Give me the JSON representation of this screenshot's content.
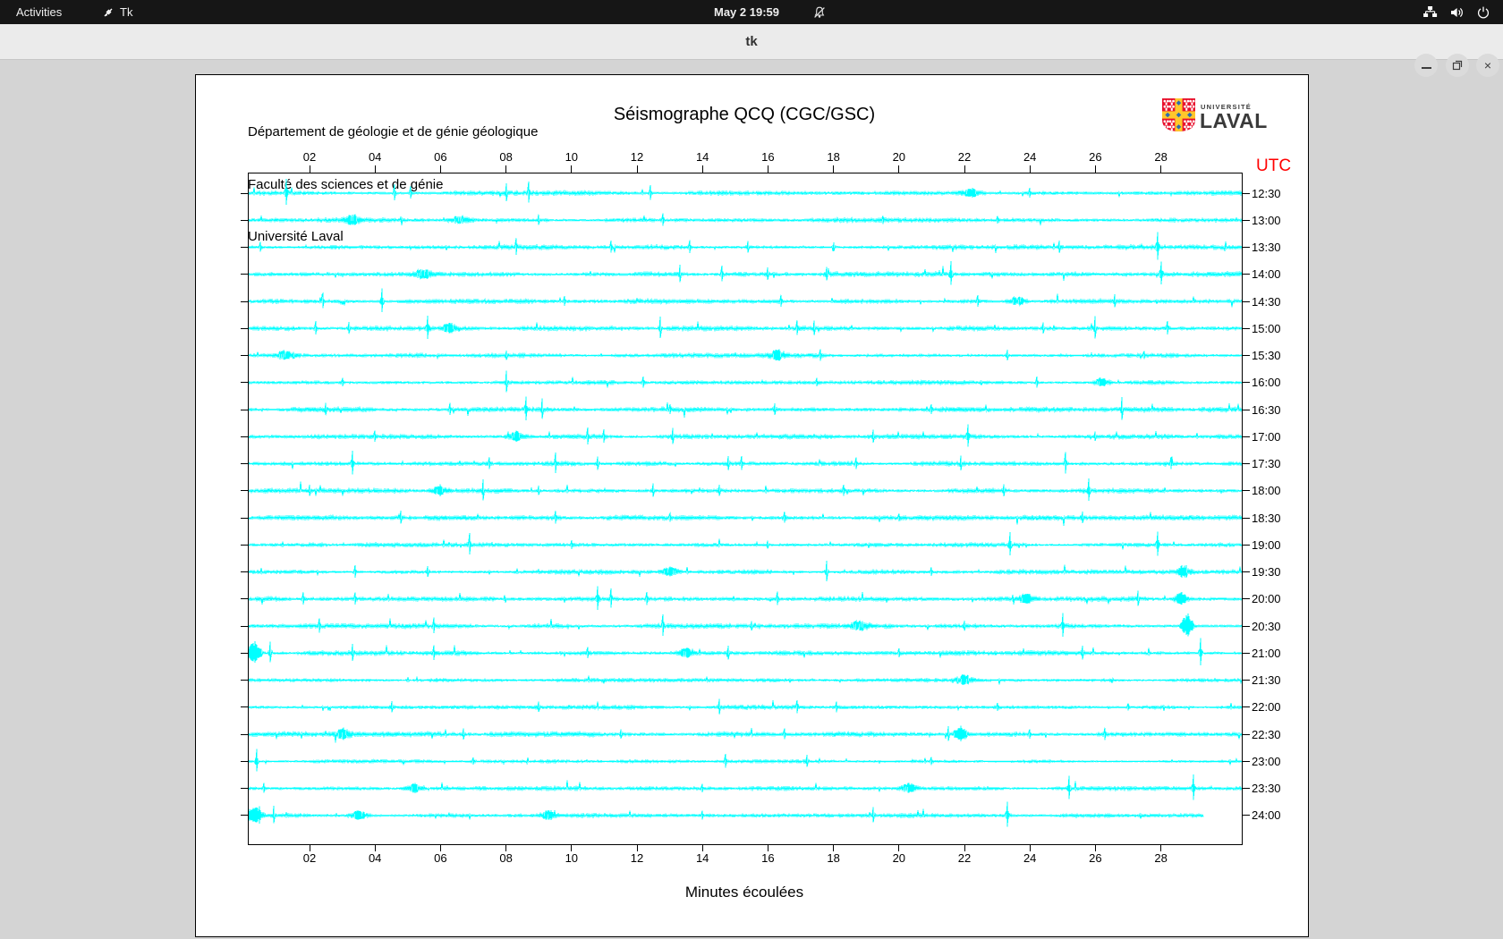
{
  "topbar": {
    "activities_label": "Activities",
    "app_indicator_label": "Tk",
    "clock": "May 2 19:59",
    "icons": [
      "tk-icon",
      "notifications-off-icon",
      "network-icon",
      "volume-icon",
      "power-icon"
    ]
  },
  "titlebar": {
    "title": "tk",
    "buttons": [
      "minimize",
      "maximize",
      "close"
    ]
  },
  "header": {
    "lines": [
      "Département de géologie et de génie géologique",
      "Faculté des sciences et de génie",
      "Université Laval"
    ]
  },
  "logo": {
    "line1": "UNIVERSITÉ",
    "line2": "LAVAL"
  },
  "colors": {
    "trace": "#00ffff",
    "utc_label": "#ff0000",
    "frame": "#000000",
    "logo_red": "#e8112d",
    "logo_yellow": "#ffc72c",
    "logo_blue": "#2b6db0",
    "topbar_bg": "#161616",
    "titlebar_bg": "#ebebeb"
  },
  "chart_data": {
    "type": "line",
    "subtype": "seismogram-helicorder",
    "title": "Séismographe QCQ (CGC/GSC)",
    "xlabel": "Minutes écoulées",
    "right_axis_label": "UTC",
    "x_range_minutes": [
      0,
      30
    ],
    "x_ticks": [
      "02",
      "04",
      "06",
      "08",
      "10",
      "12",
      "14",
      "16",
      "18",
      "20",
      "22",
      "24",
      "26",
      "28"
    ],
    "grid": false,
    "legend": false,
    "spike_fields": "minute, amplitude_px, half_width_px(optional)",
    "rows": [
      {
        "utc": "12:30",
        "noise": 1.8,
        "spikes": [
          [
            1.3,
            14
          ],
          [
            4.6,
            9
          ],
          [
            5.1,
            7
          ],
          [
            8.0,
            10
          ],
          [
            8.7,
            12
          ],
          [
            12.4,
            8
          ],
          [
            22.2,
            6,
            16
          ],
          [
            24.0,
            5
          ]
        ]
      },
      {
        "utc": "13:00",
        "noise": 1.8,
        "spikes": [
          [
            3.3,
            6,
            14
          ],
          [
            6.6,
            5,
            18
          ],
          [
            9.0,
            5
          ],
          [
            12.8,
            7
          ],
          [
            19.5,
            4
          ],
          [
            23.0,
            4
          ]
        ]
      },
      {
        "utc": "13:30",
        "noise": 1.8,
        "spikes": [
          [
            0.5,
            5
          ],
          [
            8.3,
            8
          ],
          [
            11.2,
            6
          ],
          [
            13.6,
            7
          ],
          [
            15.4,
            6
          ],
          [
            18.0,
            5
          ],
          [
            24.9,
            6
          ],
          [
            27.9,
            16
          ]
        ]
      },
      {
        "utc": "14:00",
        "noise": 2.0,
        "spikes": [
          [
            5.5,
            5,
            20
          ],
          [
            13.3,
            10
          ],
          [
            14.6,
            9
          ],
          [
            16.0,
            6
          ],
          [
            17.8,
            7
          ],
          [
            21.6,
            14
          ],
          [
            28.0,
            13
          ]
        ]
      },
      {
        "utc": "14:30",
        "noise": 1.8,
        "spikes": [
          [
            2.4,
            8
          ],
          [
            4.2,
            14
          ],
          [
            9.8,
            5
          ],
          [
            16.4,
            6
          ],
          [
            22.4,
            6
          ],
          [
            23.6,
            6,
            14
          ],
          [
            26.6,
            7
          ]
        ]
      },
      {
        "utc": "15:00",
        "noise": 1.8,
        "spikes": [
          [
            2.2,
            7
          ],
          [
            3.2,
            6
          ],
          [
            5.6,
            13
          ],
          [
            6.3,
            6,
            12
          ],
          [
            12.7,
            12
          ],
          [
            16.9,
            8
          ],
          [
            17.4,
            7
          ],
          [
            24.4,
            6
          ],
          [
            26.0,
            12
          ],
          [
            28.2,
            7
          ]
        ]
      },
      {
        "utc": "15:30",
        "noise": 1.7,
        "spikes": [
          [
            1.3,
            6,
            16
          ],
          [
            8.0,
            4
          ],
          [
            16.3,
            6,
            14
          ],
          [
            17.6,
            5
          ],
          [
            23.3,
            6
          ],
          [
            27.5,
            4
          ]
        ]
      },
      {
        "utc": "16:00",
        "noise": 1.7,
        "spikes": [
          [
            3.0,
            4
          ],
          [
            8.0,
            12
          ],
          [
            12.2,
            6
          ],
          [
            17.5,
            4
          ],
          [
            24.2,
            6
          ],
          [
            26.2,
            6,
            12
          ]
        ]
      },
      {
        "utc": "16:30",
        "noise": 2.2,
        "spikes": [
          [
            2.5,
            6
          ],
          [
            6.3,
            7
          ],
          [
            8.6,
            13
          ],
          [
            9.1,
            11
          ],
          [
            13.0,
            5
          ],
          [
            16.2,
            6
          ],
          [
            21.0,
            5
          ],
          [
            26.8,
            12
          ]
        ]
      },
      {
        "utc": "17:00",
        "noise": 1.8,
        "spikes": [
          [
            4.0,
            6
          ],
          [
            8.3,
            6,
            14
          ],
          [
            10.5,
            8
          ],
          [
            11.0,
            7
          ],
          [
            13.1,
            9
          ],
          [
            19.2,
            6
          ],
          [
            22.1,
            13
          ],
          [
            26.0,
            5
          ]
        ]
      },
      {
        "utc": "17:30",
        "noise": 1.8,
        "spikes": [
          [
            3.3,
            13
          ],
          [
            7.5,
            6
          ],
          [
            9.5,
            7
          ],
          [
            10.8,
            7
          ],
          [
            14.8,
            8
          ],
          [
            15.2,
            7
          ],
          [
            18.7,
            6
          ],
          [
            21.9,
            7
          ],
          [
            25.1,
            12
          ],
          [
            28.3,
            6
          ]
        ]
      },
      {
        "utc": "18:00",
        "noise": 1.8,
        "spikes": [
          [
            2.0,
            5
          ],
          [
            6.0,
            6,
            14
          ],
          [
            7.3,
            12
          ],
          [
            9.0,
            5
          ],
          [
            12.5,
            7
          ],
          [
            14.5,
            6
          ],
          [
            18.3,
            6
          ],
          [
            23.2,
            6
          ],
          [
            25.8,
            13
          ]
        ]
      },
      {
        "utc": "18:30",
        "noise": 2.2,
        "spikes": [
          [
            4.8,
            7
          ],
          [
            9.5,
            6
          ],
          [
            13.0,
            4
          ],
          [
            16.5,
            6
          ],
          [
            20.0,
            4
          ],
          [
            25.6,
            6
          ]
        ]
      },
      {
        "utc": "19:00",
        "noise": 1.6,
        "spikes": [
          [
            6.9,
            12
          ],
          [
            10.0,
            4
          ],
          [
            16.0,
            4
          ],
          [
            23.4,
            13
          ],
          [
            27.9,
            14
          ]
        ]
      },
      {
        "utc": "19:30",
        "noise": 1.7,
        "spikes": [
          [
            3.4,
            7
          ],
          [
            5.6,
            6
          ],
          [
            13.0,
            6,
            14
          ],
          [
            17.8,
            12
          ],
          [
            21.0,
            4
          ],
          [
            28.7,
            7,
            12
          ]
        ]
      },
      {
        "utc": "20:00",
        "noise": 1.8,
        "spikes": [
          [
            1.8,
            7
          ],
          [
            3.4,
            6
          ],
          [
            10.8,
            13
          ],
          [
            11.2,
            10
          ],
          [
            12.3,
            7
          ],
          [
            16.3,
            7
          ],
          [
            23.9,
            6,
            14
          ],
          [
            27.3,
            7
          ],
          [
            28.6,
            8,
            10
          ]
        ]
      },
      {
        "utc": "20:30",
        "noise": 1.8,
        "spikes": [
          [
            2.3,
            7
          ],
          [
            5.8,
            8
          ],
          [
            12.8,
            12
          ],
          [
            15.5,
            5
          ],
          [
            18.8,
            6,
            14
          ],
          [
            22.0,
            5
          ],
          [
            25.0,
            13
          ],
          [
            28.8,
            15,
            8
          ]
        ]
      },
      {
        "utc": "21:00",
        "noise": 1.8,
        "spikes": [
          [
            0.3,
            14,
            10
          ],
          [
            0.8,
            12
          ],
          [
            3.3,
            8
          ],
          [
            5.8,
            7
          ],
          [
            10.5,
            6
          ],
          [
            13.5,
            6,
            12
          ],
          [
            14.8,
            7
          ],
          [
            20.0,
            4
          ],
          [
            25.6,
            7
          ],
          [
            29.2,
            16
          ]
        ]
      },
      {
        "utc": "21:30",
        "noise": 1.4,
        "spikes": [
          [
            5.0,
            3
          ],
          [
            11.0,
            3
          ],
          [
            22.0,
            6,
            16
          ],
          [
            26.5,
            3
          ]
        ]
      },
      {
        "utc": "22:00",
        "noise": 1.6,
        "spikes": [
          [
            4.5,
            6
          ],
          [
            9.0,
            5
          ],
          [
            14.5,
            6
          ],
          [
            16.9,
            7
          ],
          [
            18.1,
            5
          ],
          [
            23.0,
            4
          ],
          [
            27.0,
            4
          ]
        ]
      },
      {
        "utc": "22:30",
        "noise": 2.2,
        "spikes": [
          [
            3.0,
            6,
            14
          ],
          [
            6.7,
            6
          ],
          [
            11.5,
            5
          ],
          [
            16.5,
            6
          ],
          [
            21.5,
            8
          ],
          [
            21.9,
            9,
            10
          ],
          [
            24.0,
            5
          ],
          [
            26.3,
            6
          ]
        ]
      },
      {
        "utc": "23:00",
        "noise": 1.3,
        "spikes": [
          [
            0.4,
            13
          ],
          [
            7.0,
            4
          ],
          [
            14.7,
            8
          ],
          [
            17.2,
            6
          ],
          [
            21.0,
            4
          ]
        ]
      },
      {
        "utc": "23:30",
        "noise": 1.6,
        "spikes": [
          [
            0.6,
            5
          ],
          [
            5.2,
            6,
            14
          ],
          [
            14.0,
            4
          ],
          [
            20.3,
            6,
            14
          ],
          [
            25.2,
            13
          ],
          [
            29.0,
            14
          ]
        ]
      },
      {
        "utc": "24:00",
        "noise": 1.8,
        "end": 29.3,
        "spikes": [
          [
            0.3,
            12,
            12
          ],
          [
            0.9,
            10
          ],
          [
            3.5,
            6,
            14
          ],
          [
            9.3,
            6,
            12
          ],
          [
            14.0,
            4
          ],
          [
            19.2,
            8
          ],
          [
            23.3,
            14
          ]
        ]
      }
    ]
  }
}
